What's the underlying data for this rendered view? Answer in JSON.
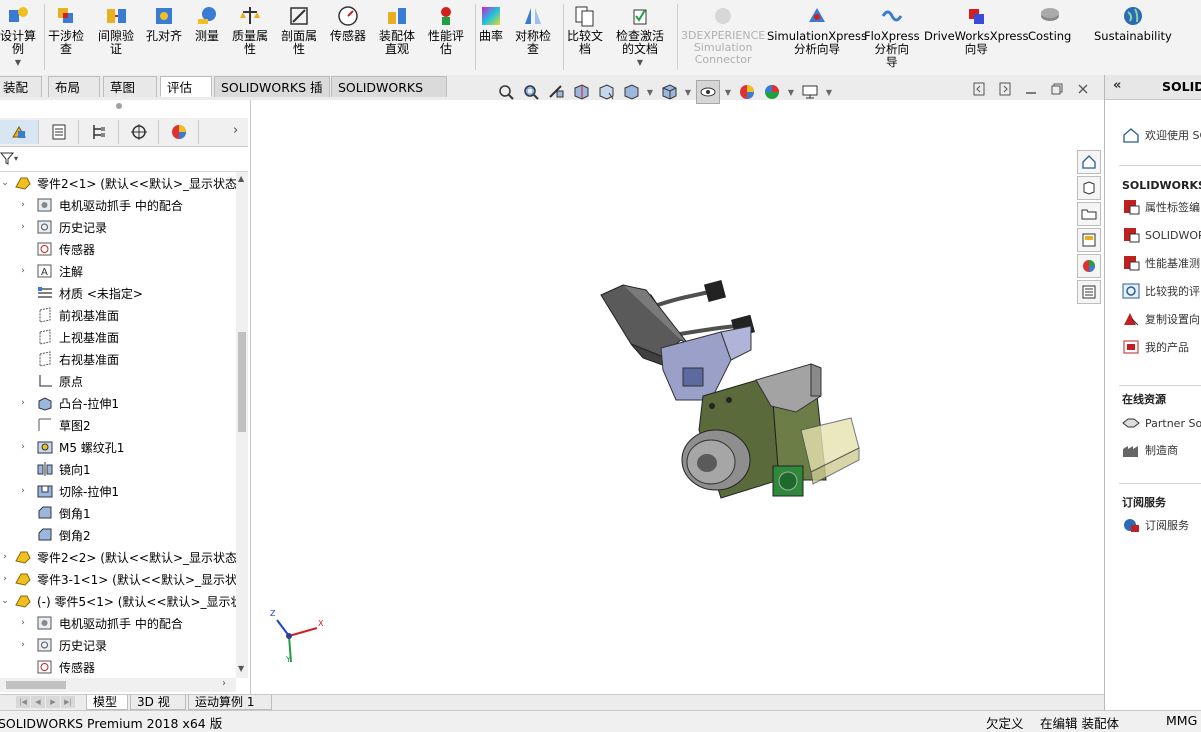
{
  "ribbon": {
    "buttons": [
      {
        "label": "设计算\n例"
      },
      {
        "label": "干涉检\n查"
      },
      {
        "label": "间隙验\n证"
      },
      {
        "label": "孔对齐"
      },
      {
        "label": "测量"
      },
      {
        "label": "质量属\n性"
      },
      {
        "label": "剖面属\n性"
      },
      {
        "label": "传感器"
      },
      {
        "label": "装配体\n直观"
      },
      {
        "label": "性能评\n估"
      },
      {
        "label": "曲率"
      },
      {
        "label": "对称检\n查"
      },
      {
        "label": "比较文\n档"
      },
      {
        "label": "检查激活\n的文档"
      },
      {
        "label": "3DEXPERIENCE\nSimulation\nConnector"
      },
      {
        "label": "SimulationXpress\n分析向导"
      },
      {
        "label": "FloXpress\n分析向\n导"
      },
      {
        "label": "DriveWorksXpress\n向导"
      },
      {
        "label": "Costing"
      },
      {
        "label": "Sustainability"
      }
    ]
  },
  "command_tabs": [
    "装配体",
    "布局",
    "草图",
    "评估",
    "SOLIDWORKS 插件",
    "SOLIDWORKS MBD"
  ],
  "tree": {
    "items": [
      {
        "label": "零件2<1> (默认<<默认>_显示状态"
      },
      {
        "label": "电机驱动抓手 中的配合"
      },
      {
        "label": "历史记录"
      },
      {
        "label": "传感器"
      },
      {
        "label": "注解"
      },
      {
        "label": "材质 <未指定>"
      },
      {
        "label": "前视基准面"
      },
      {
        "label": "上视基准面"
      },
      {
        "label": "右视基准面"
      },
      {
        "label": "原点"
      },
      {
        "label": "凸台-拉伸1"
      },
      {
        "label": "草图2"
      },
      {
        "label": "M5 螺纹孔1"
      },
      {
        "label": "镜向1"
      },
      {
        "label": "切除-拉伸1"
      },
      {
        "label": "倒角1"
      },
      {
        "label": "倒角2"
      },
      {
        "label": "零件2<2> (默认<<默认>_显示状态"
      },
      {
        "label": "零件3-1<1> (默认<<默认>_显示状态"
      },
      {
        "label": "(-) 零件5<1> (默认<<默认>_显示状"
      },
      {
        "label": "电机驱动抓手 中的配合"
      },
      {
        "label": "历史记录"
      },
      {
        "label": "传感器"
      }
    ]
  },
  "triad": {
    "x": "X",
    "y": "Y",
    "z": "Z"
  },
  "taskpane": {
    "title": "SOLID",
    "welcome": "欢迎使用 SO",
    "tools_header": "SOLIDWORKS 工",
    "tools": [
      "属性标签编",
      "SOLIDWOR",
      "性能基准测",
      "比较我的评",
      "复制设置向",
      "我的产品"
    ],
    "online_header": "在线资源",
    "online": [
      "Partner Soli",
      "制造商"
    ],
    "subscription_header": "订阅服务",
    "subscription": [
      "订阅服务"
    ]
  },
  "bottom_tabs": [
    "模型",
    "3D 视图",
    "运动算例 1"
  ],
  "status": {
    "product": "SOLIDWORKS Premium 2018 x64 版",
    "custom": "欠定义",
    "editing": "在编辑 装配体",
    "units": "MMG"
  }
}
